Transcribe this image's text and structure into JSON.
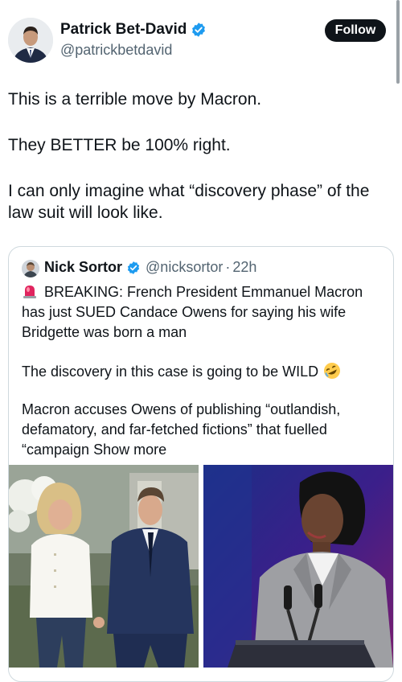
{
  "author": {
    "name": "Patrick Bet-David",
    "handle": "@patrickbetdavid",
    "verified_icon": "verified-badge-icon",
    "follow_label": "Follow"
  },
  "tweet": {
    "lines": [
      "This is a terrible move by Macron.",
      "They BETTER be 100% right.",
      "I can only imagine what “discovery phase” of the",
      "law suit will look like."
    ]
  },
  "quote": {
    "name": "Nick Sortor",
    "handle": "@nicksortor",
    "separator": "·",
    "time": "22h",
    "line1": "BREAKING: French President Emmanuel Macron",
    "line2": "has just SUED Candace Owens for saying his wife",
    "line3": "Bridgette was born a man",
    "line4": "The discovery in this case is going to be WILD",
    "line5": "Macron accuses Owens of publishing “outlandish,",
    "line6": "defamatory, and far-fetched fictions” that fuelled",
    "line7": "“campaign",
    "show_more": "Show more",
    "icons": {
      "siren": "siren-emoji-icon",
      "laugh": "rolling-laughing-emoji-icon"
    }
  },
  "colors": {
    "text": "#0f1419",
    "secondary": "#536471",
    "verified": "#1d9bf0",
    "border": "#cfd9de",
    "follow_bg": "#0f1419"
  }
}
